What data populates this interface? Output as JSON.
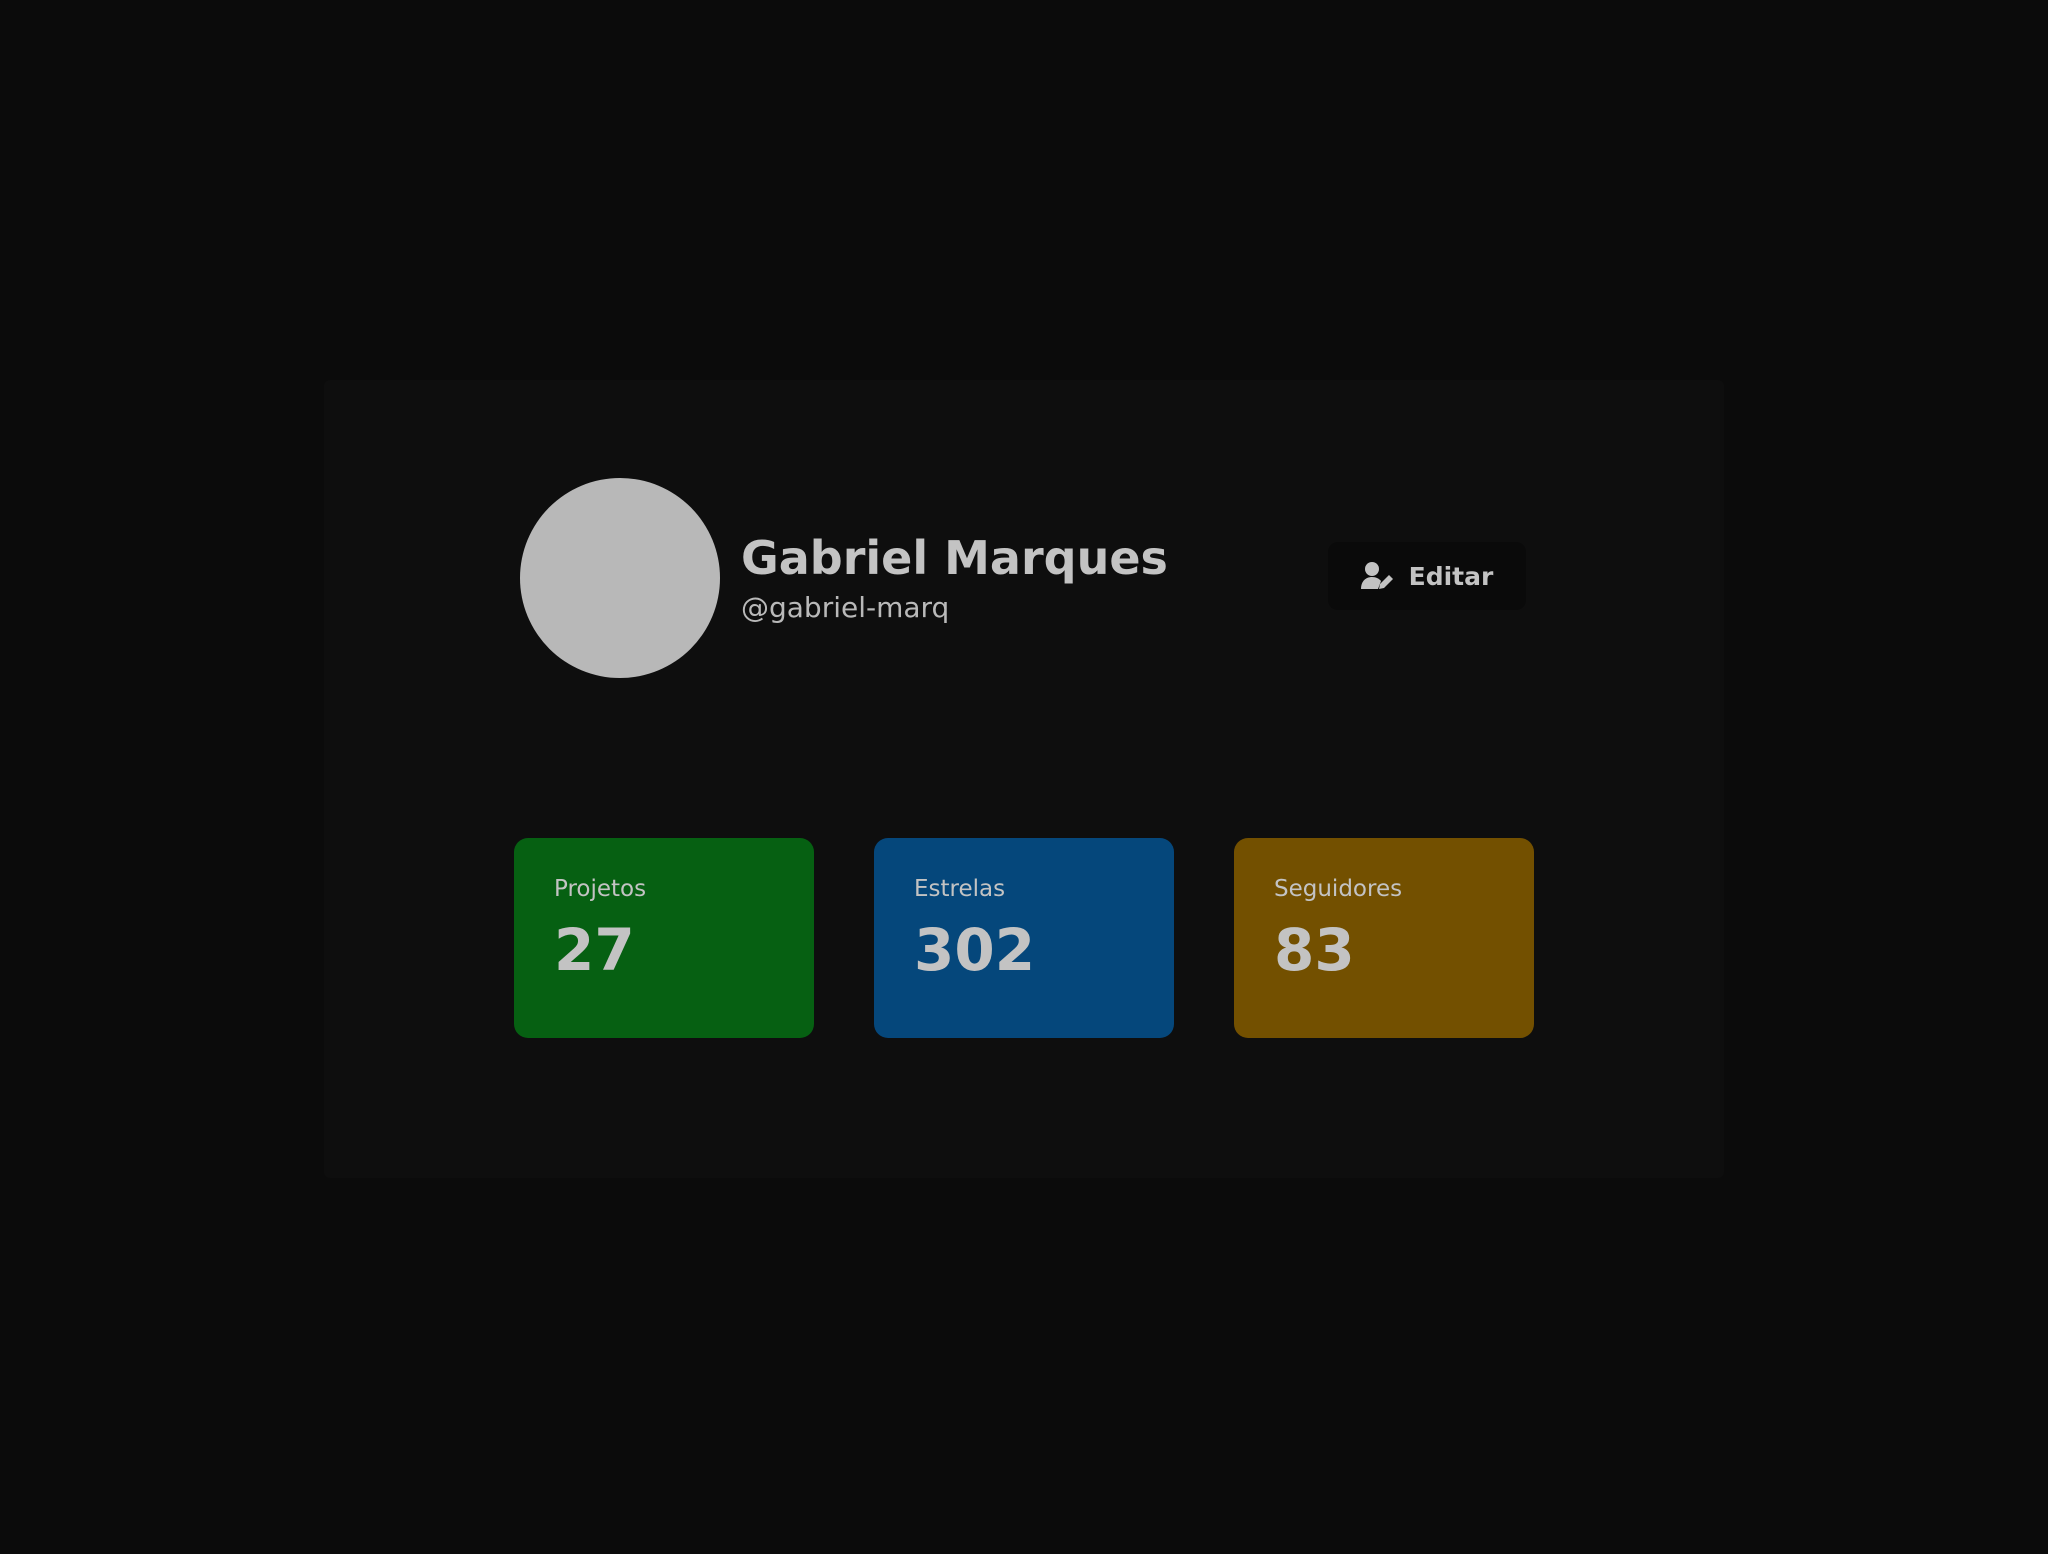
{
  "profile": {
    "name": "Gabriel Marques",
    "handle": "@gabriel-marq"
  },
  "edit_button": {
    "label": "Editar",
    "icon": "user-edit-icon"
  },
  "stats": [
    {
      "label": "Projetos",
      "value": "27",
      "color": "#066012"
    },
    {
      "label": "Estrelas",
      "value": "302",
      "color": "#05477b"
    },
    {
      "label": "Seguidores",
      "value": "83",
      "color": "#735000"
    }
  ],
  "colors": {
    "background": "#0b0b0b",
    "card": "#0e0e0e",
    "avatar": "#b8b8b8",
    "text": "#c3c3c3"
  }
}
